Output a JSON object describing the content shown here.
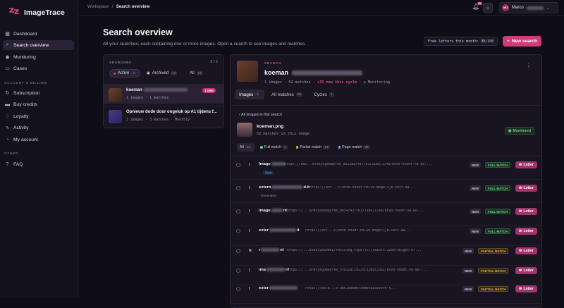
{
  "app": {
    "name": "ImageTrace"
  },
  "sidebar": {
    "nav": [
      {
        "label": "Dashboard",
        "icon": "grid-icon"
      },
      {
        "label": "Search overview",
        "icon": "search-icon"
      },
      {
        "label": "Monitoring",
        "icon": "eye-icon"
      },
      {
        "label": "Cases",
        "icon": "folder-icon"
      }
    ],
    "account_section": "ACCOUNT & BILLING",
    "account": [
      {
        "label": "Subscription",
        "icon": "refresh-icon"
      },
      {
        "label": "Buy credits",
        "icon": "card-icon"
      },
      {
        "label": "Loyalty",
        "icon": "gift-icon"
      },
      {
        "label": "Activity",
        "icon": "activity-icon"
      },
      {
        "label": "My account",
        "icon": "user-icon"
      }
    ],
    "other_section": "OTHER",
    "other": [
      {
        "label": "FAQ",
        "icon": "help-icon"
      }
    ]
  },
  "topbar": {
    "crumb_root": "Workspace",
    "crumb_sep": "/",
    "crumb_current": "Search overview",
    "notif_count": "9+",
    "user_initials": "MO",
    "user_name": "Marco"
  },
  "header": {
    "title": "Search overview",
    "subtitle": "All your searches, each containing one or more images. Open a search to see images and matches.",
    "free_letters": "Free letters this month: 98/100",
    "new_search": "New search"
  },
  "searches": {
    "heading": "SEARCHES",
    "page": "2 / 2",
    "filters": [
      {
        "label": "Active",
        "count": "2"
      },
      {
        "label": "Archived",
        "count": "17"
      },
      {
        "label": "All",
        "count": "19"
      }
    ],
    "items": [
      {
        "title": "koeman",
        "meta": "1 images · 1 matches",
        "badge": "1 new"
      },
      {
        "title": "Opnieuw dode door ongeluk op A1 tijdens f...",
        "meta": "3 images · 3 matches · Monthly"
      }
    ]
  },
  "detail": {
    "label": "SEARCH",
    "title": "koeman",
    "meta_images": "1 images",
    "meta_matches": "52 matches",
    "meta_new": "+35 new this cycle",
    "meta_monitor": "Monitoring",
    "tabs": [
      {
        "label": "Images",
        "count": "1"
      },
      {
        "label": "All matches",
        "count": "52"
      },
      {
        "label": "Cycles",
        "count": "1"
      }
    ],
    "back": "All images in this search",
    "image_name": "koeman.png",
    "image_meta": "52 matches in this image",
    "monitored": "Monitored",
    "chips": [
      {
        "label": "All",
        "count": "52"
      },
      {
        "label": "Full match",
        "count": "4"
      },
      {
        "label": "Partial match",
        "count": "13"
      },
      {
        "label": "Page match",
        "count": "35"
      }
    ],
    "matches": [
      {
        "type": "I",
        "name": "Image",
        "url": "https://ima...m/mtyxg0wayfk6_w61288/437/63/3186/1748/knvb-houdt-na-wk-...",
        "sub": "Sent",
        "kind": "FULL MATCH",
        "status": "NEW"
      },
      {
        "type": "I",
        "name": "extern",
        "suffix": "d.it",
        "url": "https://ext...t/knvb-houdt-na-wk-mogelijk-vast-aa...",
        "sub": "Generated",
        "kind": "FULL MATCH",
        "status": "NEW"
      },
      {
        "type": "I",
        "name": "image",
        "suffix": "nl",
        "url": "https://...m/mtyxg0wayfk6_w654/437/63/3186/1748/knvb-houdt-na-wk-...",
        "sub": "",
        "kind": "FULL MATCH",
        "status": "NEW"
      },
      {
        "type": "I",
        "name": "exter",
        "suffix": "it",
        "url": "https://ext...t/knvb-houdt-na-wk-mogelijk-vast-aa...",
        "sub": "",
        "kind": "FULL MATCH",
        "status": "NEW"
      },
      {
        "type": "R",
        "name": "r",
        "suffix": "nl",
        "url": "https://...zoa6526608KI/resizing_type:fill/width:1280/height:67...",
        "sub": "",
        "kind": "PARTIAL MATCH",
        "status": "NEW"
      },
      {
        "type": "I",
        "name": "ima",
        "suffix": "nl",
        "url": "https://...m/mtyxg0wayfk6_std328/292/0/3168/2362/knvb-houdt-na-wk-...",
        "sub": "",
        "kind": "PARTIAL MATCH",
        "status": "NEW"
      },
      {
        "type": "I",
        "name": "exter",
        "url": "https://exte...d-d6k15b6HKtXdmeva3d0v8fh-t...",
        "sub": "",
        "kind": "PARTIAL MATCH",
        "status": "NEW"
      }
    ],
    "letter": "Letter"
  },
  "colors": {
    "accent": "#d23a7a",
    "full": "#5ed48a",
    "partial": "#e0a84a",
    "page": "#6aa6f0"
  }
}
